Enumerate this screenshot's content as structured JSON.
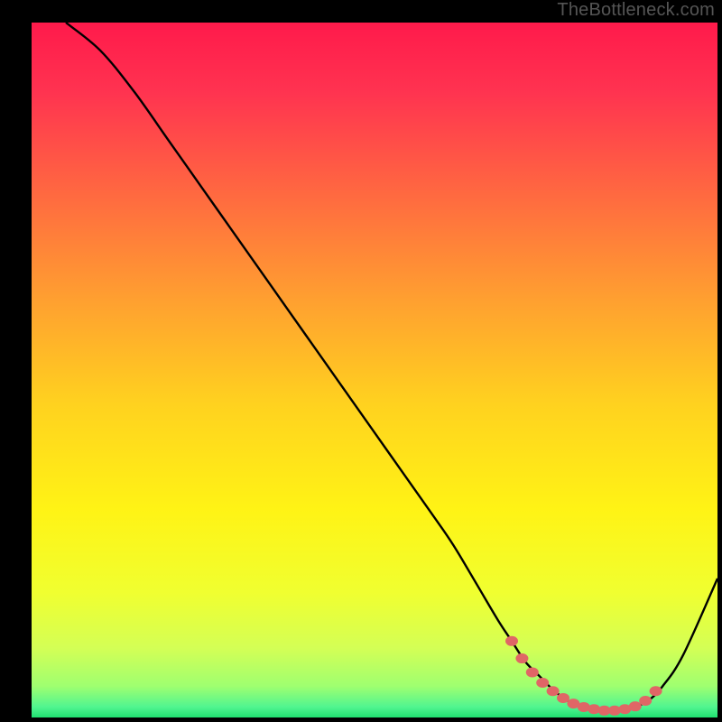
{
  "watermark": "TheBottleneck.com",
  "chart_data": {
    "type": "line",
    "title": "",
    "xlabel": "",
    "ylabel": "",
    "xlim": [
      0,
      100
    ],
    "ylim": [
      0,
      100
    ],
    "grid": false,
    "series": [
      {
        "name": "curve",
        "color": "#000000",
        "x": [
          5,
          10,
          15,
          20,
          25,
          30,
          35,
          40,
          45,
          50,
          55,
          60,
          62,
          65,
          68,
          70,
          72,
          74,
          76,
          78,
          80,
          82,
          84,
          86,
          88,
          90,
          92,
          95,
          100
        ],
        "y": [
          100,
          96,
          90,
          83,
          76,
          69,
          62,
          55,
          48,
          41,
          34,
          27,
          24,
          19,
          14,
          11,
          8,
          6,
          4,
          2.5,
          1.5,
          1,
          1,
          1,
          1.5,
          2.5,
          4.5,
          9,
          20
        ]
      }
    ],
    "markers": {
      "name": "highlight-dots",
      "color": "#e06666",
      "x": [
        70,
        71.5,
        73,
        74.5,
        76,
        77.5,
        79,
        80.5,
        82,
        83.5,
        85,
        86.5,
        88,
        89.5,
        91
      ],
      "y": [
        11,
        8.5,
        6.5,
        5,
        3.8,
        2.8,
        2,
        1.5,
        1.2,
        1,
        1,
        1.2,
        1.6,
        2.4,
        3.8
      ]
    },
    "gradient_stops": [
      {
        "offset": 0.0,
        "color": "#ff1a4b"
      },
      {
        "offset": 0.1,
        "color": "#ff3350"
      },
      {
        "offset": 0.25,
        "color": "#ff6a40"
      },
      {
        "offset": 0.4,
        "color": "#ffa030"
      },
      {
        "offset": 0.55,
        "color": "#ffd21f"
      },
      {
        "offset": 0.7,
        "color": "#fff315"
      },
      {
        "offset": 0.82,
        "color": "#f0ff30"
      },
      {
        "offset": 0.9,
        "color": "#d4ff55"
      },
      {
        "offset": 0.955,
        "color": "#9fff70"
      },
      {
        "offset": 0.985,
        "color": "#50f590"
      },
      {
        "offset": 1.0,
        "color": "#20e070"
      }
    ]
  }
}
